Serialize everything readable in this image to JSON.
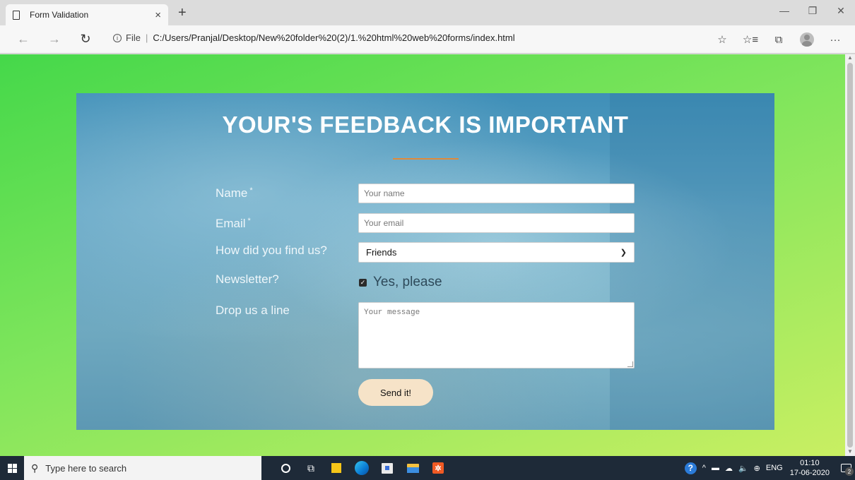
{
  "browser": {
    "tab_title": "Form Validation",
    "tab_close": "×",
    "new_tab": "+",
    "back": "←",
    "forward": "→",
    "refresh": "↻",
    "url_label": "File",
    "url_separator": "|",
    "url": "C:/Users/Pranjal/Desktop/New%20folder%20(2)/1.%20html%20web%20forms/index.html",
    "win_minimize": "—",
    "win_restore": "❐",
    "win_close": "✕",
    "toolbar": {
      "favorite": "☆",
      "favorites_list": "☆≡",
      "collections": "⧉",
      "more": "···"
    }
  },
  "form": {
    "title": "YOUR'S FEEDBACK IS IMPORTANT",
    "name_label": "Name",
    "name_required": "*",
    "name_placeholder": "Your name",
    "email_label": "Email",
    "email_required": "*",
    "email_placeholder": "Your email",
    "source_label": "How did you find us?",
    "source_selected": "Friends",
    "newsletter_label": "Newsletter?",
    "newsletter_checked": true,
    "newsletter_option": "Yes, please",
    "message_label": "Drop us a line",
    "message_placeholder": "Your message",
    "submit_label": "Send it!"
  },
  "taskbar": {
    "search_placeholder": "Type here to search",
    "language": "ENG",
    "time": "01:10",
    "date": "17-06-2020",
    "notification_count": "2"
  },
  "colors": {
    "page_gradient_start": "#45d84a",
    "page_gradient_end": "#c9ef62",
    "title_underline": "#e08a3a",
    "submit_button": "#f6e3c8",
    "taskbar": "#1e2a38"
  }
}
